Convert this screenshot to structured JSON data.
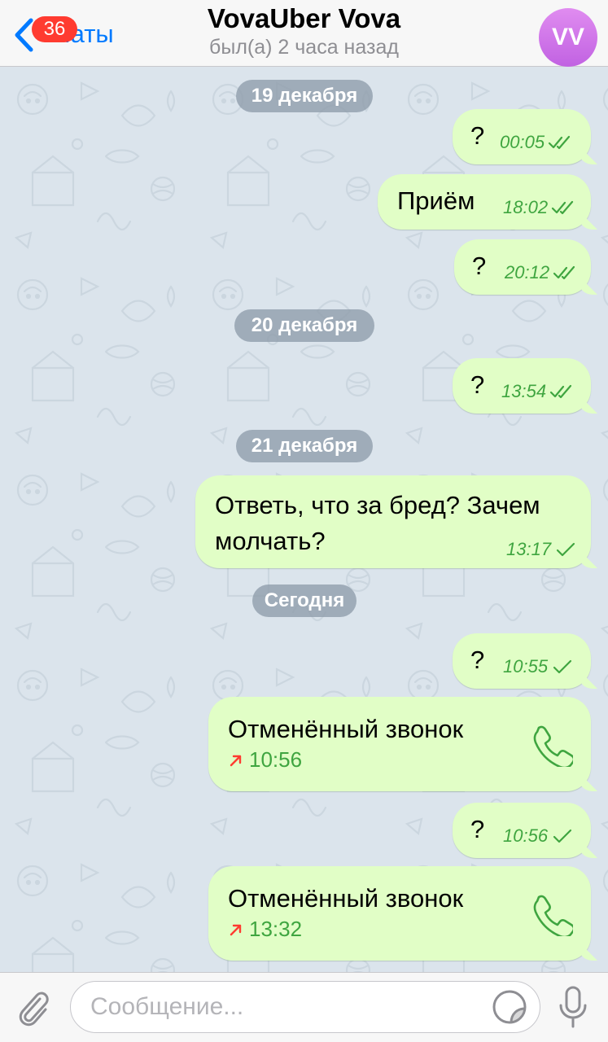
{
  "header": {
    "back_label": "Чаты",
    "unread_count": "36",
    "title": "VovaUber Vova",
    "status": "был(а) 2 часа назад",
    "avatar_initials": "VV"
  },
  "colors": {
    "accent": "#007aff",
    "badge": "#ff3b30",
    "outgoing_bubble": "#e1fec6",
    "meta_green": "#3fa540",
    "missed_call_arrow": "#ff3b30"
  },
  "messages": {
    "date_1": "19 декабря",
    "m1": {
      "text": "?",
      "time": "00:05",
      "status": "read"
    },
    "m2": {
      "text": "Приём",
      "time": "18:02",
      "status": "read"
    },
    "m3": {
      "text": "?",
      "time": "20:12",
      "status": "read"
    },
    "date_2": "20 декабря",
    "m4": {
      "text": "?",
      "time": "13:54",
      "status": "read"
    },
    "date_3": "21 декабря",
    "m5": {
      "line1": "Ответь, что за бред? Зачем",
      "line2": "молчать?",
      "time": "13:17",
      "status": "sent"
    },
    "date_4": "Сегодня",
    "m6": {
      "text": "?",
      "time": "10:55",
      "status": "sent"
    },
    "call1": {
      "title": "Отменённый звонок",
      "time": "10:56",
      "icon": "phone-icon"
    },
    "m7": {
      "text": "?",
      "time": "10:56",
      "status": "sent"
    },
    "call2": {
      "title": "Отменённый звонок",
      "time": "13:32",
      "icon": "phone-icon"
    }
  },
  "input": {
    "placeholder": "Сообщение...",
    "value": ""
  },
  "icons": {
    "back": "chevron-left-icon",
    "attach": "paperclip-icon",
    "sticker": "sticker-icon",
    "mic": "microphone-icon",
    "read": "double-check-icon",
    "sent": "single-check-icon",
    "outgoing_call": "outgoing-arrow-icon"
  }
}
